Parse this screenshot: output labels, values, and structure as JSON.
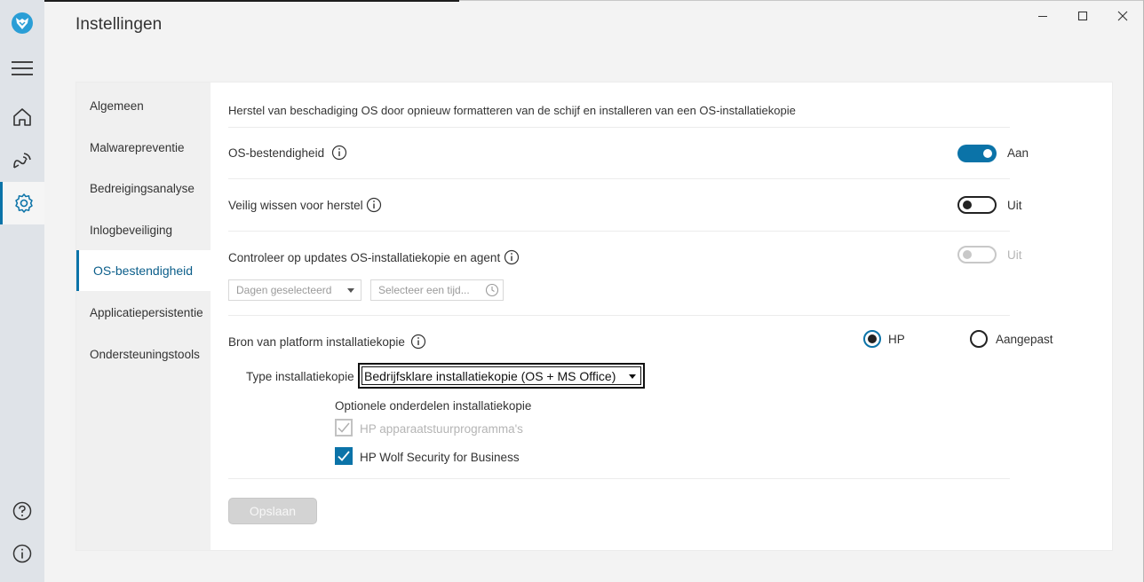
{
  "window": {
    "title": "Instellingen",
    "controls": {
      "minimize": "minimize-icon",
      "maximize": "maximize-icon",
      "close": "close-icon"
    }
  },
  "rail": {
    "items": [
      {
        "icon": "logo-icon"
      },
      {
        "icon": "hamburger-menu-icon"
      },
      {
        "icon": "home-icon"
      },
      {
        "icon": "threat-signal-icon"
      },
      {
        "icon": "gear-icon",
        "active": true
      },
      {
        "icon": "help-icon"
      },
      {
        "icon": "info-icon"
      }
    ]
  },
  "subnav": {
    "items": [
      {
        "label": "Algemeen"
      },
      {
        "label": "Malwarepreventie"
      },
      {
        "label": "Bedreigingsanalyse"
      },
      {
        "label": "Inlogbeveiliging"
      },
      {
        "label": "OS-bestendigheid",
        "active": true
      },
      {
        "label": "Applicatiepersistentie"
      },
      {
        "label": "Ondersteuningstools"
      }
    ]
  },
  "content": {
    "description": "Herstel van beschadiging OS door opnieuw formatteren van de schijf en installeren van een OS-installatiekopie",
    "resilience": {
      "label": "OS-bestendigheid",
      "state_label": "Aan",
      "enabled": true
    },
    "secure_wipe": {
      "label": "Veilig wissen voor herstel",
      "state_label": "Uit",
      "enabled": false
    },
    "updates": {
      "label": "Controleer op updates OS-installatiekopie en agent",
      "state_label": "Uit",
      "enabled": false,
      "days_placeholder": "Dagen geselecteerd",
      "time_placeholder": "Selecteer een tijd..."
    },
    "platform_source": {
      "label": "Bron van platform installatiekopie",
      "options": [
        {
          "label": "HP",
          "selected": true
        },
        {
          "label": "Aangepast",
          "selected": false
        }
      ]
    },
    "image_type": {
      "label": "Type installatiekopie",
      "value": "Bedrijfsklare installatiekopie (OS + MS Office)"
    },
    "optional": {
      "heading": "Optionele onderdelen installatiekopie",
      "items": [
        {
          "label": "HP apparaatstuurprogramma's",
          "checked": true,
          "disabled": true
        },
        {
          "label": "HP Wolf Security for Business",
          "checked": true,
          "disabled": false
        }
      ]
    },
    "save_label": "Opslaan"
  },
  "colors": {
    "accent": "#0b73a8",
    "rail_bg": "#dfe3e8",
    "panel_bg": "#ffffff",
    "subnav_bg": "#f0f0f0"
  }
}
